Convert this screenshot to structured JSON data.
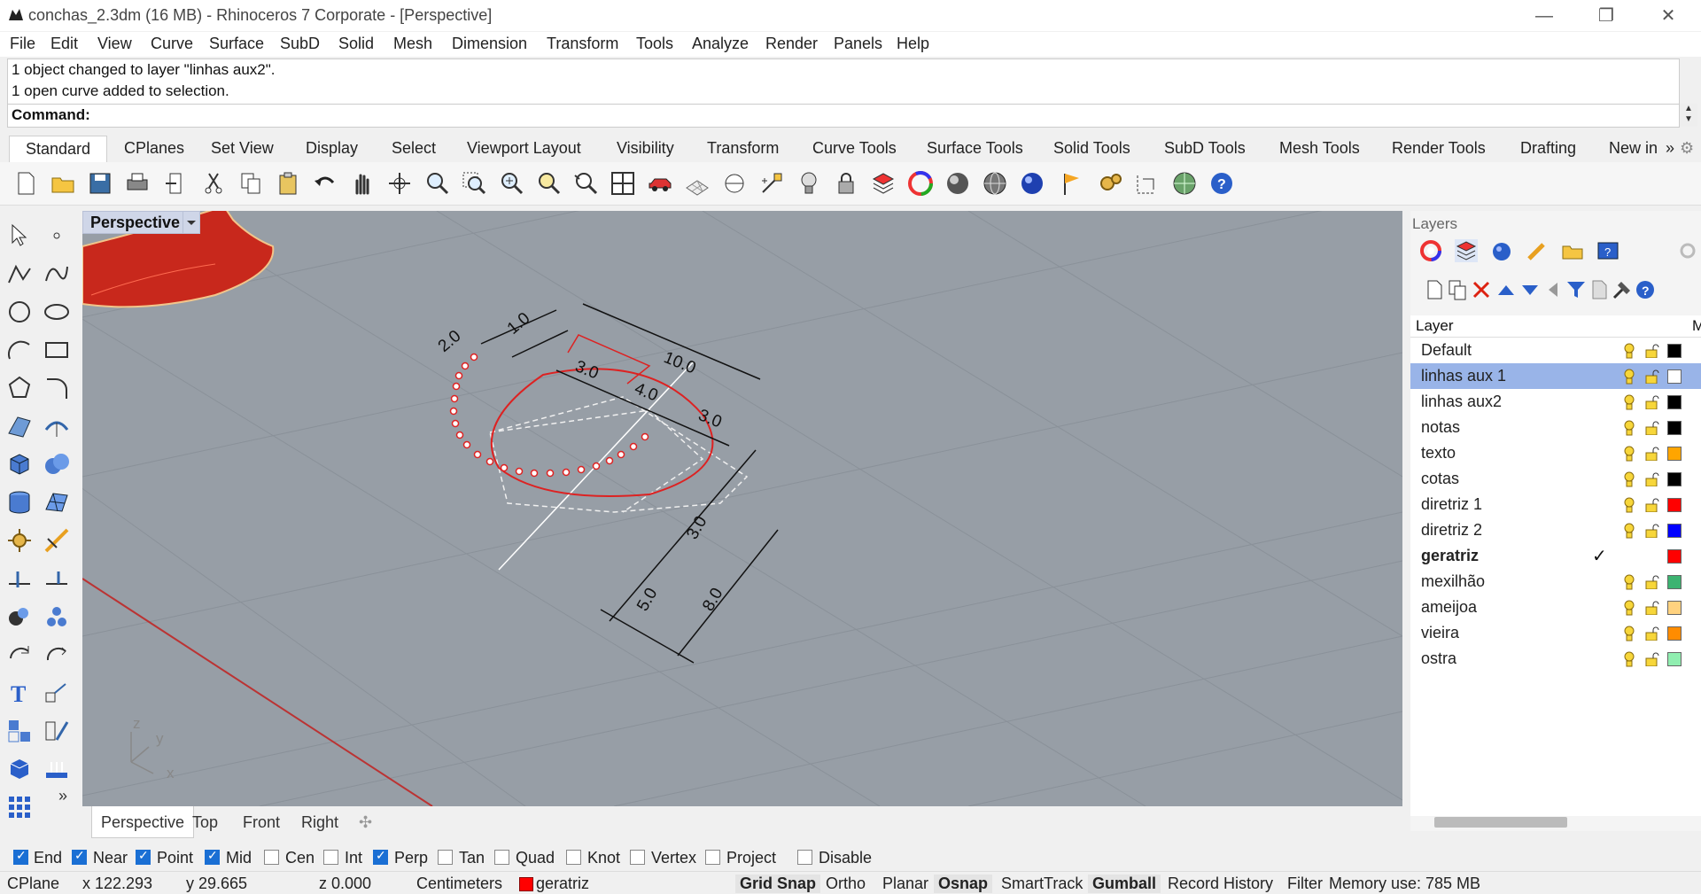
{
  "window": {
    "title": "conchas_2.3dm (16 MB) - Rhinoceros 7 Corporate - [Perspective]",
    "minimize": "—",
    "restore": "❐",
    "close": "✕"
  },
  "menu": [
    "File",
    "Edit",
    "View",
    "Curve",
    "Surface",
    "SubD",
    "Solid",
    "Mesh",
    "Dimension",
    "Transform",
    "Tools",
    "Analyze",
    "Render",
    "Panels",
    "Help"
  ],
  "command": {
    "history": [
      "1 object changed to layer \"linhas aux2\".",
      "1 open curve added to selection."
    ],
    "prompt": "Command:"
  },
  "toolbar_tabs": [
    "Standard",
    "CPlanes",
    "Set View",
    "Display",
    "Select",
    "Viewport Layout",
    "Visibility",
    "Transform",
    "Curve Tools",
    "Surface Tools",
    "Solid Tools",
    "SubD Tools",
    "Mesh Tools",
    "Render Tools",
    "Drafting",
    "New in"
  ],
  "toolbar_overflow": "»",
  "viewport": {
    "name": "Perspective",
    "dimensions": [
      "10.0",
      "1.0",
      "2.0",
      "3.0",
      "4.0",
      "3.0",
      "3.0",
      "5.0",
      "8.0"
    ],
    "axes": {
      "z": "z",
      "y": "y",
      "x": "x"
    }
  },
  "viewport_tabs": [
    "Perspective",
    "Top",
    "Front",
    "Right"
  ],
  "layers": {
    "panel_title": "Layers",
    "column_header": "Layer",
    "column_more": "M",
    "items": [
      {
        "name": "Default",
        "color": "#000000"
      },
      {
        "name": "linhas aux 1",
        "color": "#ffffff",
        "selected": true
      },
      {
        "name": "linhas aux2",
        "color": "#000000"
      },
      {
        "name": "notas",
        "color": "#000000"
      },
      {
        "name": "texto",
        "color": "#ffa500"
      },
      {
        "name": "cotas",
        "color": "#000000"
      },
      {
        "name": "diretriz 1",
        "color": "#ff0000"
      },
      {
        "name": "diretriz 2",
        "color": "#0000ff"
      },
      {
        "name": "geratriz",
        "color": "#ff0000",
        "current": true
      },
      {
        "name": "mexilhão",
        "color": "#3cb371"
      },
      {
        "name": "ameijoa",
        "color": "#ffd27f"
      },
      {
        "name": "vieira",
        "color": "#ff8c00"
      },
      {
        "name": "ostra",
        "color": "#90eeb0"
      }
    ]
  },
  "osnaps": [
    {
      "label": "End",
      "checked": true
    },
    {
      "label": "Near",
      "checked": true
    },
    {
      "label": "Point",
      "checked": true
    },
    {
      "label": "Mid",
      "checked": true
    },
    {
      "label": "Cen",
      "checked": false
    },
    {
      "label": "Int",
      "checked": false
    },
    {
      "label": "Perp",
      "checked": true
    },
    {
      "label": "Tan",
      "checked": false
    },
    {
      "label": "Quad",
      "checked": false
    },
    {
      "label": "Knot",
      "checked": false
    },
    {
      "label": "Vertex",
      "checked": false
    },
    {
      "label": "Project",
      "checked": false
    },
    {
      "label": "Disable",
      "checked": false
    }
  ],
  "status": {
    "cplane": "CPlane",
    "x": "x 122.293",
    "y": "y 29.665",
    "z": "z 0.000",
    "units": "Centimeters",
    "layer": "geratriz",
    "layer_color": "#ff0000",
    "grid_snap": "Grid Snap",
    "ortho": "Ortho",
    "planar": "Planar",
    "osnap": "Osnap",
    "smarttrack": "SmartTrack",
    "gumball": "Gumball",
    "record_history": "Record History",
    "filter": "Filter",
    "memory": "Memory use: 785 MB"
  }
}
